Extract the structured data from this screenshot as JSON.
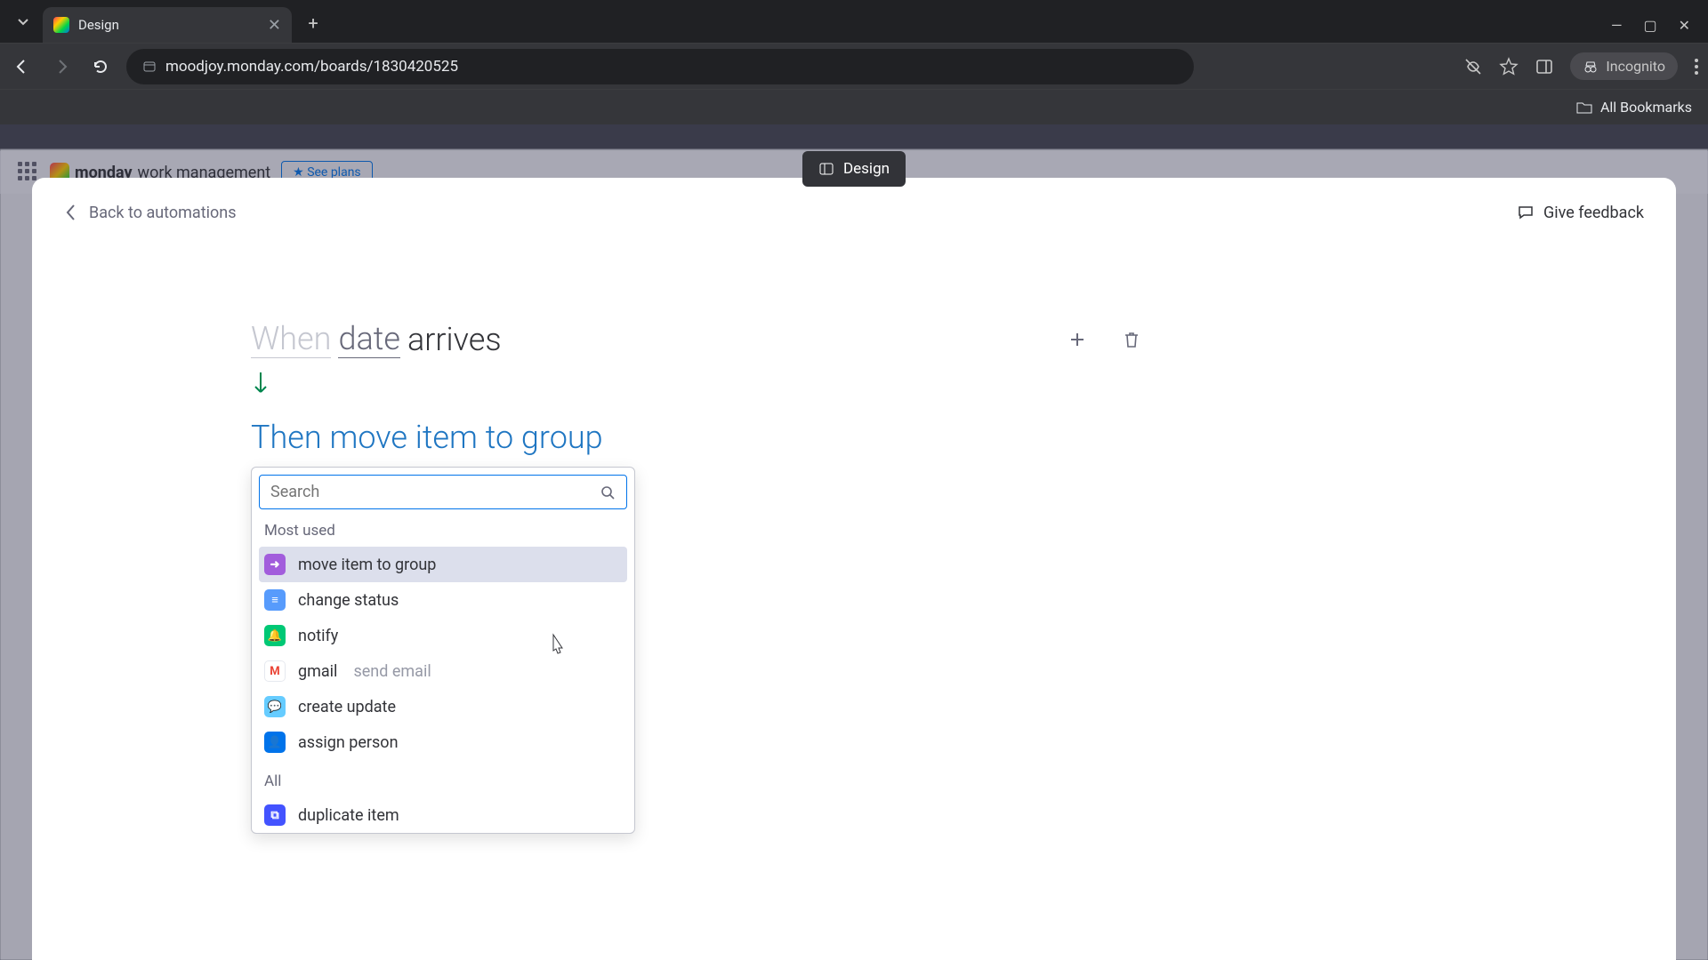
{
  "browser": {
    "tab_title": "Design",
    "url": "moodjoy.monday.com/boards/1830420525",
    "incognito_label": "Incognito",
    "all_bookmarks": "All Bookmarks"
  },
  "page": {
    "brand": "monday",
    "brand_sub": "work management",
    "see_plans": "See plans",
    "center_pill": "Design"
  },
  "modal": {
    "back_label": "Back to automations",
    "feedback_label": "Give feedback",
    "trigger": {
      "when": "When",
      "date": "date",
      "arrives": "arrives"
    },
    "action_sentence": "Then move item to group",
    "search_placeholder": "Search",
    "sections": {
      "most_used": "Most used",
      "all": "All"
    },
    "options": {
      "move_item": "move item to group",
      "change_status": "change status",
      "notify": "notify",
      "gmail": "gmail",
      "gmail_sub": "send email",
      "create_update": "create update",
      "assign_person": "assign person",
      "duplicate_item": "duplicate item"
    }
  }
}
